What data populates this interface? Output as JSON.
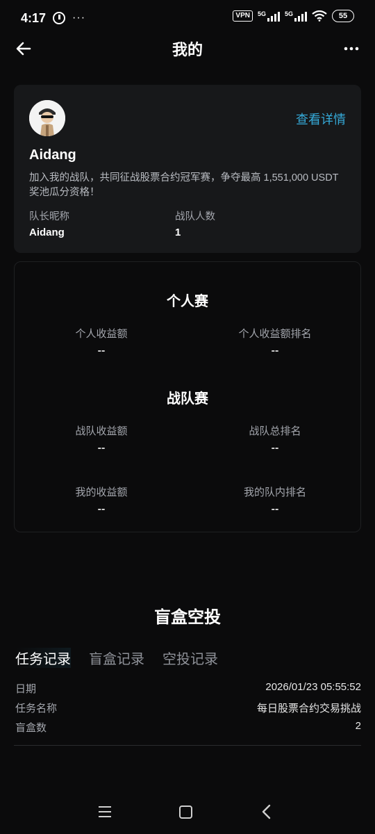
{
  "status_bar": {
    "time": "4:17",
    "dots": "···",
    "vpn": "VPN",
    "network1": "5G",
    "network2": "5G",
    "battery": "55"
  },
  "header": {
    "title": "我的"
  },
  "profile": {
    "view_details": "查看详情",
    "name": "Aidang",
    "description": "加入我的战队，共同征战股票合约冠军赛，争夺最高 1,551,000 USDT 奖池瓜分资格！",
    "captain_label": "队长昵称",
    "captain_value": "Aidang",
    "members_label": "战队人数",
    "members_value": "1"
  },
  "individual": {
    "title": "个人赛",
    "earnings_label": "个人收益额",
    "earnings_value": "--",
    "rank_label": "个人收益额排名",
    "rank_value": "--"
  },
  "team": {
    "title": "战队赛",
    "earnings_label": "战队收益额",
    "earnings_value": "--",
    "rank_label": "战队总排名",
    "rank_value": "--",
    "my_earnings_label": "我的收益额",
    "my_earnings_value": "--",
    "my_rank_label": "我的队内排名",
    "my_rank_value": "--"
  },
  "blind_box": {
    "title": "盲盒空投",
    "tabs": [
      {
        "label": "任务记录",
        "active": true
      },
      {
        "label": "盲盒记录",
        "active": false
      },
      {
        "label": "空投记录",
        "active": false
      }
    ],
    "records": [
      {
        "label": "日期",
        "value": "2026/01/23 05:55:52"
      },
      {
        "label": "任务名称",
        "value": "每日股票合约交易挑战"
      },
      {
        "label": "盲盒数",
        "value": "2"
      }
    ]
  },
  "colors": {
    "accent": "#35a9d8",
    "background": "#0b0b0c",
    "card": "#17181a"
  }
}
